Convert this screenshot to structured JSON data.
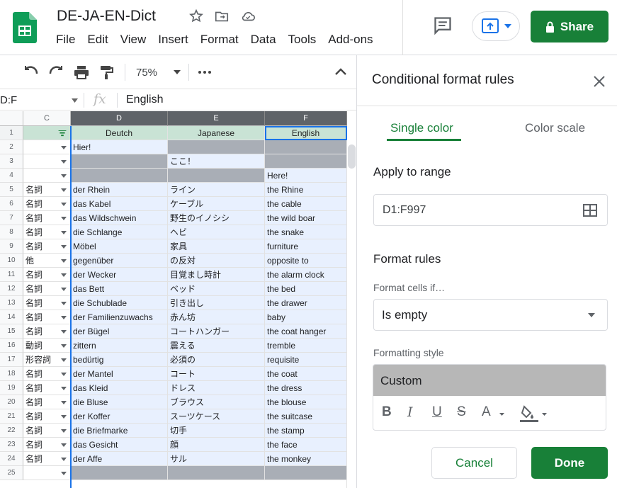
{
  "app": {
    "doc_title": "DE-JA-EN-Dict",
    "menus": [
      "File",
      "Edit",
      "View",
      "Insert",
      "Format",
      "Data",
      "Tools",
      "Add-ons"
    ],
    "share_label": "Share",
    "accent_color": "#188038"
  },
  "toolbar": {
    "zoom": "75%"
  },
  "formula_bar": {
    "name_box": "D:F",
    "fx": "fx",
    "value": "English"
  },
  "grid": {
    "columns": [
      "C",
      "D",
      "E",
      "F"
    ],
    "header_row": {
      "num": "1",
      "D": "Deutch",
      "E": "Japanese",
      "F": "English"
    },
    "rows": [
      {
        "num": "2",
        "C": "",
        "D": "Hier!",
        "E": "",
        "F": ""
      },
      {
        "num": "3",
        "C": "",
        "D": "",
        "E": "ここ！",
        "F": ""
      },
      {
        "num": "4",
        "C": "",
        "D": "",
        "E": "",
        "F": "Here!"
      },
      {
        "num": "5",
        "C": "名詞",
        "D": "der Rhein",
        "E": "ライン",
        "F": "the Rhine"
      },
      {
        "num": "6",
        "C": "名詞",
        "D": "das Kabel",
        "E": "ケーブル",
        "F": "the cable"
      },
      {
        "num": "7",
        "C": "名詞",
        "D": "das Wildschwein",
        "E": "野生のイノシシ",
        "F": "the wild boar"
      },
      {
        "num": "8",
        "C": "名詞",
        "D": "die Schlange",
        "E": "ヘビ",
        "F": "the snake"
      },
      {
        "num": "9",
        "C": "名詞",
        "D": "Möbel",
        "E": "家具",
        "F": "furniture"
      },
      {
        "num": "10",
        "C": "他",
        "D": "gegenüber",
        "E": "の反対",
        "F": "opposite to"
      },
      {
        "num": "11",
        "C": "名詞",
        "D": "der Wecker",
        "E": "目覚まし時計",
        "F": "the alarm clock"
      },
      {
        "num": "12",
        "C": "名詞",
        "D": "das Bett",
        "E": "ベッド",
        "F": "the bed"
      },
      {
        "num": "13",
        "C": "名詞",
        "D": "die Schublade",
        "E": "引き出し",
        "F": "the drawer"
      },
      {
        "num": "14",
        "C": "名詞",
        "D": "der Familienzuwachs",
        "E": "赤ん坊",
        "F": "baby"
      },
      {
        "num": "15",
        "C": "名詞",
        "D": "der Bügel",
        "E": "コートハンガー",
        "F": "the coat hanger"
      },
      {
        "num": "16",
        "C": "動詞",
        "D": "zittern",
        "E": "震える",
        "F": "tremble"
      },
      {
        "num": "17",
        "C": "形容詞",
        "D": "bedürtig",
        "E": "必須の",
        "F": "requisite"
      },
      {
        "num": "18",
        "C": "名詞",
        "D": "der Mantel",
        "E": "コート",
        "F": "the coat"
      },
      {
        "num": "19",
        "C": "名詞",
        "D": "das Kleid",
        "E": "ドレス",
        "F": "the dress"
      },
      {
        "num": "20",
        "C": "名詞",
        "D": "die Bluse",
        "E": "ブラウス",
        "F": "the blouse"
      },
      {
        "num": "21",
        "C": "名詞",
        "D": "der Koffer",
        "E": "スーツケース",
        "F": "the suitcase"
      },
      {
        "num": "22",
        "C": "名詞",
        "D": "die Briefmarke",
        "E": "切手",
        "F": "the stamp"
      },
      {
        "num": "23",
        "C": "名詞",
        "D": "das Gesicht",
        "E": "顔",
        "F": "the face"
      },
      {
        "num": "24",
        "C": "名詞",
        "D": "der Affe",
        "E": "サル",
        "F": "the monkey"
      },
      {
        "num": "25",
        "C": "",
        "D": "",
        "E": "",
        "F": ""
      }
    ]
  },
  "panel": {
    "title": "Conditional format rules",
    "tab_single": "Single color",
    "tab_scale": "Color scale",
    "apply_range_label": "Apply to range",
    "range_value": "D1:F997",
    "format_rules_label": "Format rules",
    "format_cells_if_label": "Format cells if…",
    "condition_value": "Is empty",
    "formatting_style_label": "Formatting style",
    "style_preview": "Custom",
    "style_buttons": [
      "B",
      "I",
      "U",
      "S",
      "A"
    ],
    "cancel_label": "Cancel",
    "done_label": "Done"
  }
}
